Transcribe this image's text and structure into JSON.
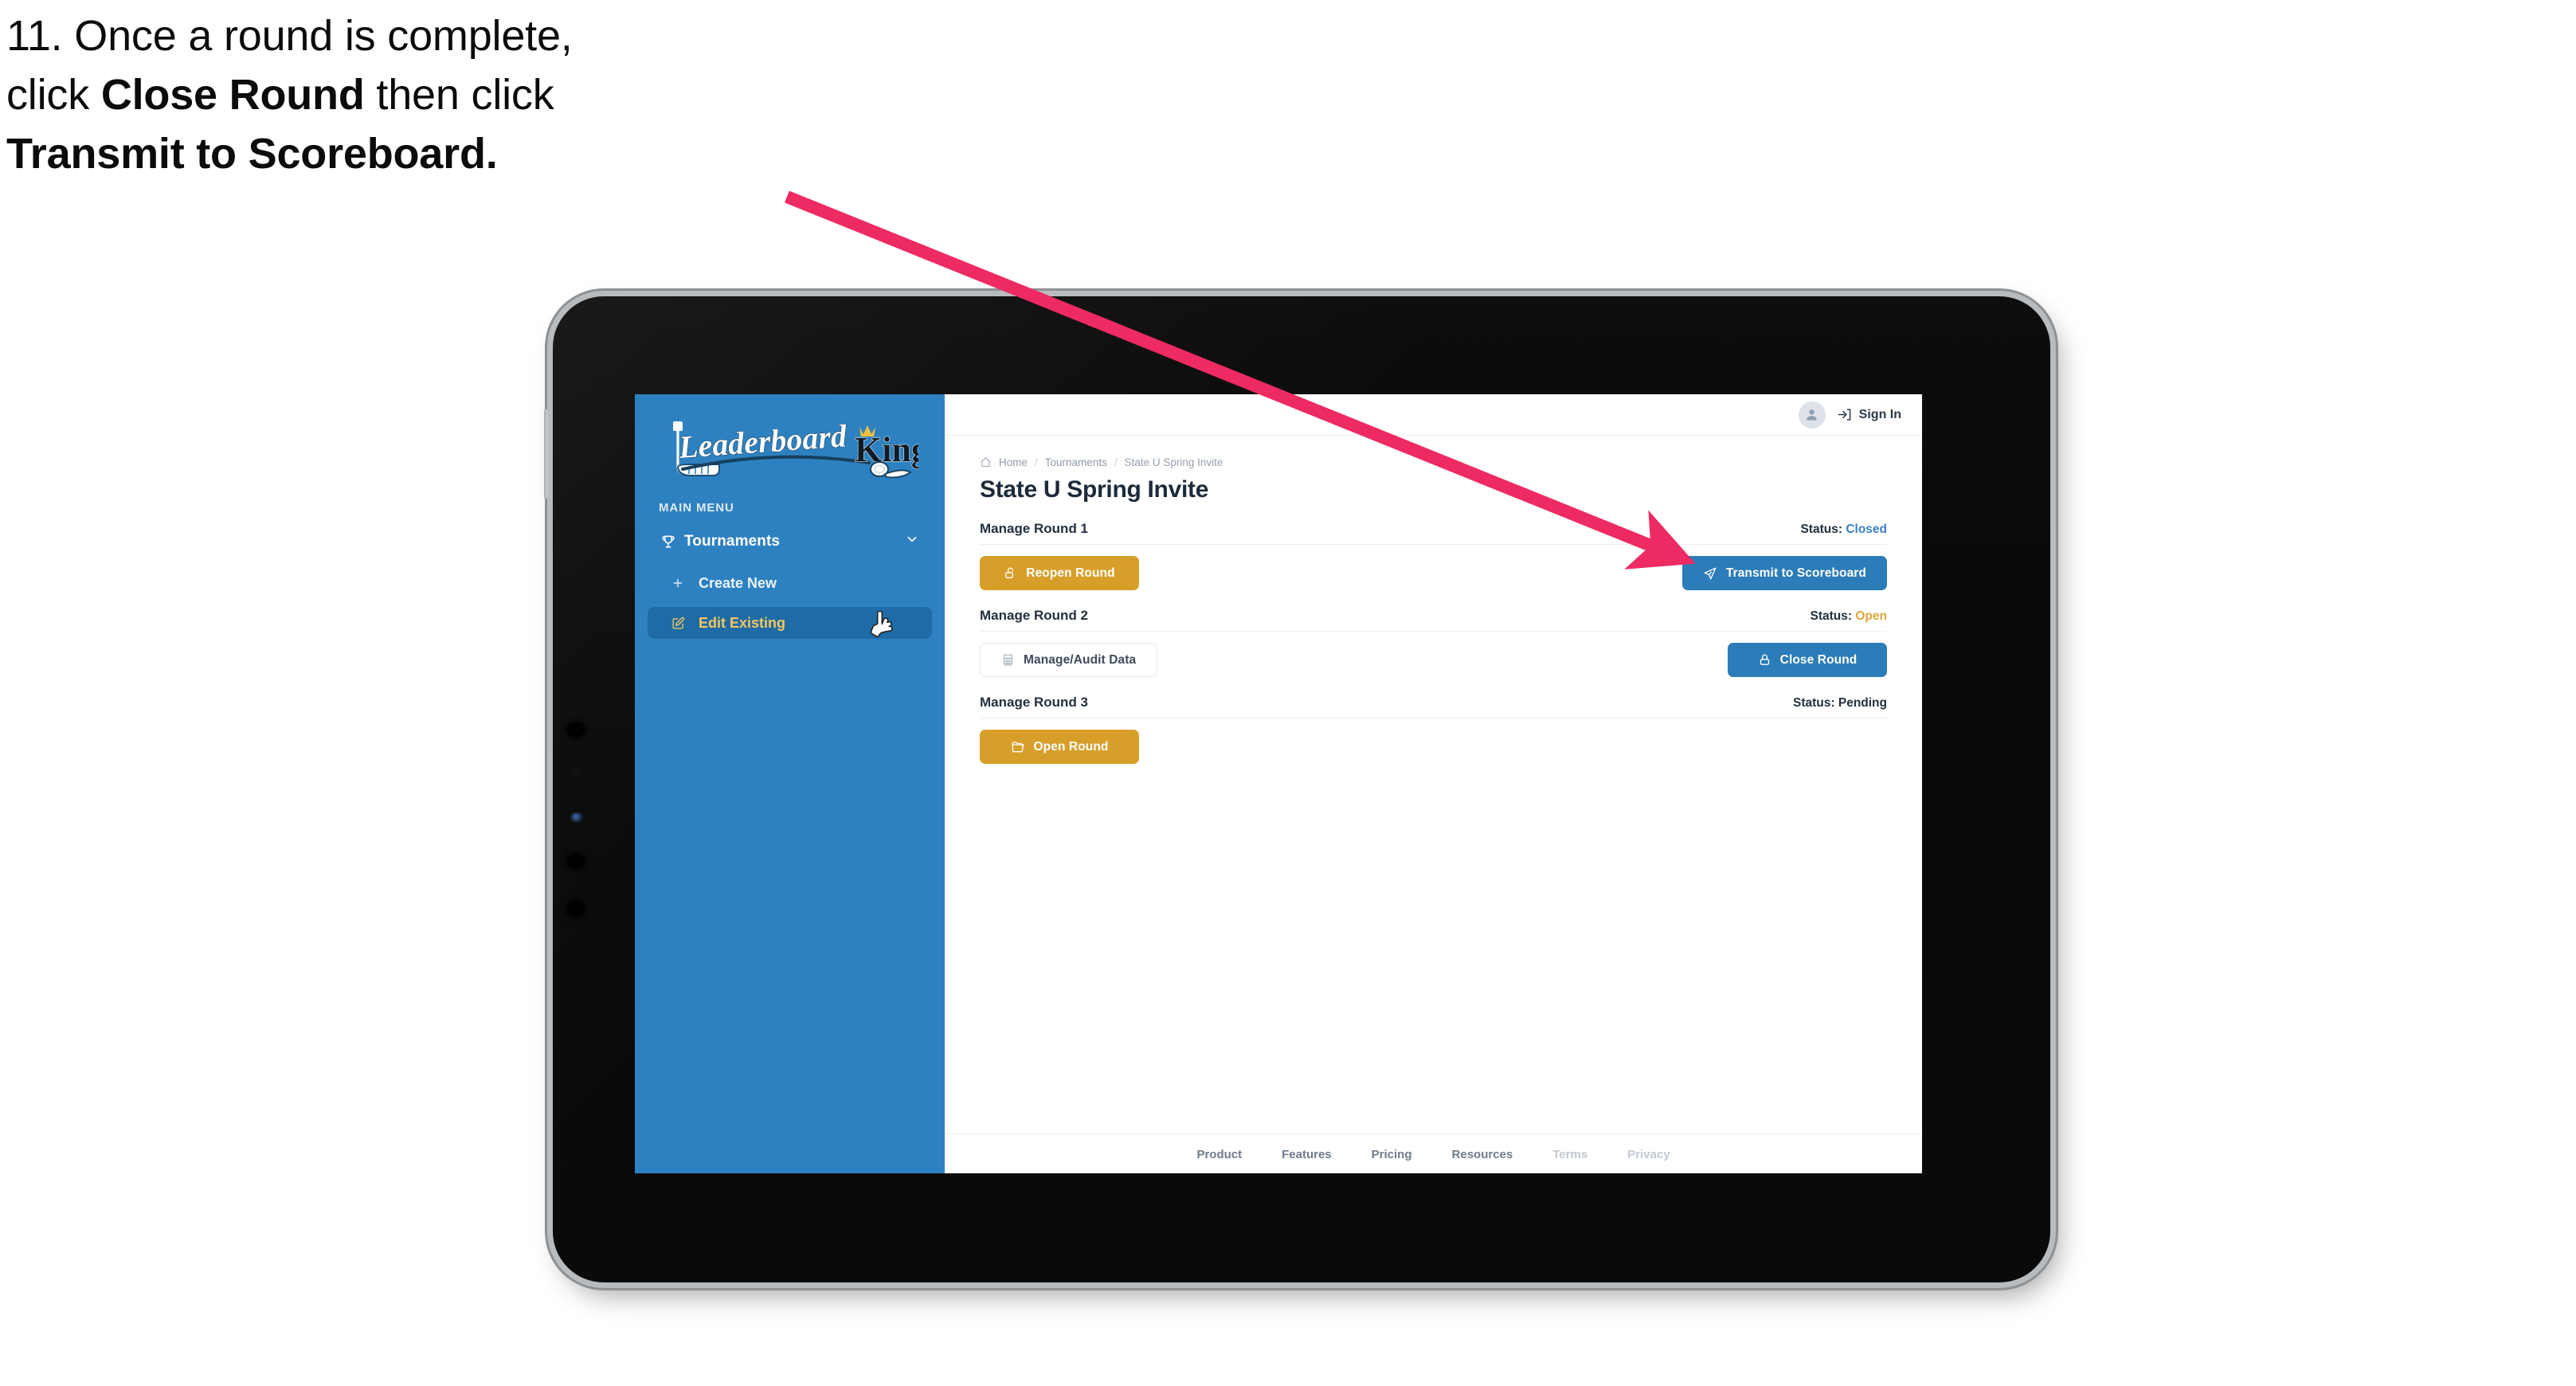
{
  "caption": {
    "line1": "11. Once a round is complete,",
    "line2_pre": "click ",
    "line2_bold": "Close Round",
    "line2_post": " then click",
    "line3_bold": "Transmit to Scoreboard."
  },
  "annotation": {
    "arrow_color": "#ee2a63",
    "points_from": "caption",
    "points_to": "transmit-to-scoreboard-button"
  },
  "app": {
    "logo_text_1": "Leaderboard",
    "logo_text_2": "King",
    "sidebar": {
      "section_label": "MAIN MENU",
      "items": [
        {
          "label": "Tournaments",
          "icon": "trophy-icon",
          "expanded": true,
          "chevron": "chevron-down-icon"
        }
      ],
      "sub_items": [
        {
          "label": "Create New",
          "icon": "plus-icon",
          "active": false
        },
        {
          "label": "Edit Existing",
          "icon": "edit-square-icon",
          "active": true
        }
      ],
      "bg_color": "#2e81c0",
      "active_bg_color": "#1e6ba6",
      "active_text_color": "#f2c760"
    },
    "topbar": {
      "avatar": "user-avatar-icon",
      "sign_in_label": "Sign In",
      "sign_in_icon": "login-arrow-icon"
    },
    "breadcrumb": {
      "home_icon": "home-icon",
      "items": [
        "Home",
        "Tournaments",
        "State U Spring Invite"
      ],
      "separator": "/"
    },
    "page_title": "State U Spring Invite",
    "rounds": [
      {
        "title": "Manage Round 1",
        "status_label": "Status:",
        "status_value": "Closed",
        "status_state": "closed",
        "left_button": {
          "label": "Reopen Round",
          "icon": "unlock-icon",
          "style": "gold"
        },
        "right_button": {
          "label": "Transmit to Scoreboard",
          "icon": "send-plane-icon",
          "style": "blue"
        }
      },
      {
        "title": "Manage Round 2",
        "status_label": "Status:",
        "status_value": "Open",
        "status_state": "open",
        "left_button": {
          "label": "Manage/Audit Data",
          "icon": "table-grid-icon",
          "style": "ghost"
        },
        "right_button": {
          "label": "Close Round",
          "icon": "lock-icon",
          "style": "blue"
        }
      },
      {
        "title": "Manage Round 3",
        "status_label": "Status:",
        "status_value": "Pending",
        "status_state": "pending",
        "left_button": {
          "label": "Open Round",
          "icon": "folder-open-icon",
          "style": "gold"
        },
        "right_button": null
      }
    ],
    "footer": {
      "links": [
        {
          "label": "Product",
          "muted": false
        },
        {
          "label": "Features",
          "muted": false
        },
        {
          "label": "Pricing",
          "muted": false
        },
        {
          "label": "Resources",
          "muted": false
        },
        {
          "label": "Terms",
          "muted": true
        },
        {
          "label": "Privacy",
          "muted": true
        }
      ]
    },
    "colors": {
      "brand_blue": "#2e81c0",
      "button_blue": "#2b7cb8",
      "button_gold": "#d79f2a",
      "status_closed": "#3a7fc1",
      "status_open": "#e0a33a",
      "text_dark": "#233040"
    }
  },
  "device": {
    "type": "tablet",
    "cursor": "pointer-hand-cursor"
  }
}
